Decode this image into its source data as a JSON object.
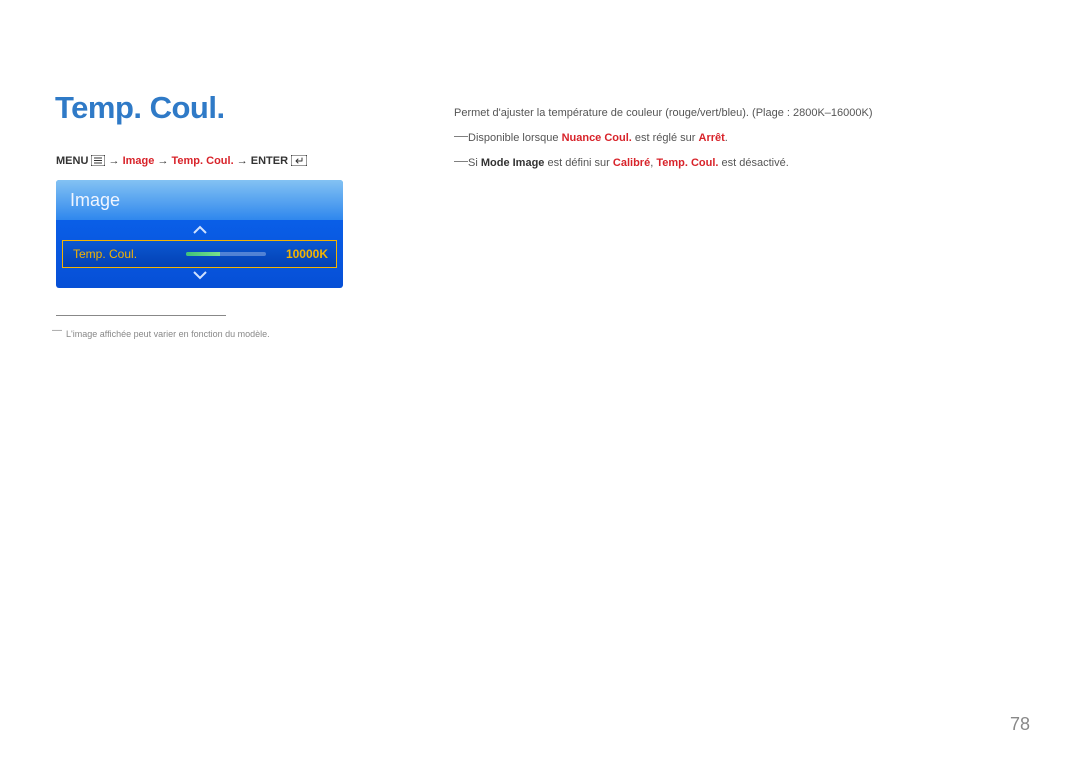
{
  "title": "Temp. Coul.",
  "breadcrumb": {
    "menu_label": "MENU",
    "arrow": "→",
    "image_label": "Image",
    "temp_label": "Temp. Coul.",
    "enter_label": "ENTER"
  },
  "menu_panel": {
    "header": "Image",
    "item": {
      "label": "Temp. Coul.",
      "value": "10000K"
    }
  },
  "image_footnote": "L'image affichée peut varier en fonction du modèle.",
  "right": {
    "description": "Permet d'ajuster la température de couleur (rouge/vert/bleu). (Plage : 2800K–16000K)",
    "note1_pre": "Disponible lorsque ",
    "note1_hl": "Nuance Coul.",
    "note1_mid": " est réglé sur ",
    "note1_hl2": "Arrêt",
    "note1_end": ".",
    "note2_pre": "Si ",
    "note2_b1": "Mode Image",
    "note2_mid1": " est défini sur ",
    "note2_hl1": "Calibré",
    "note2_sep": ", ",
    "note2_hl2": "Temp. Coul.",
    "note2_end": " est désactivé."
  },
  "page_number": "78"
}
